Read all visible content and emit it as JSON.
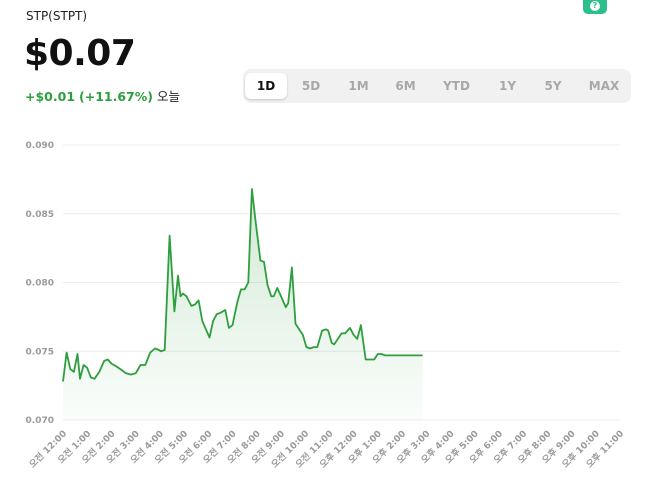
{
  "header": {
    "ticker": "STP(STPT)",
    "price": "$0.07",
    "change_abs": "+$0.01",
    "change_pct": "(+11.67%)",
    "change_period": "오늘"
  },
  "badge_icon": "app-badge-icon",
  "ranges": {
    "items": [
      "1D",
      "5D",
      "1M",
      "6M",
      "YTD",
      "1Y",
      "5Y",
      "MAX"
    ],
    "selected": "1D"
  },
  "colors": {
    "line": "#2e9e3e",
    "positive": "#2e9e3e",
    "badge": "#2bbf8c"
  },
  "chart_data": {
    "type": "area",
    "ylim": [
      0.07,
      0.09
    ],
    "yticks": [
      "0.090",
      "0.085",
      "0.080",
      "0.075",
      "0.070"
    ],
    "grid": true,
    "xlim": [
      0,
      23
    ],
    "xticks": [
      "오전 12:00",
      "오전 1:00",
      "오전 2:00",
      "오전 3:00",
      "오전 4:00",
      "오전 5:00",
      "오전 6:00",
      "오전 7:00",
      "오전 8:00",
      "오전 9:00",
      "오전 10:00",
      "오전 11:00",
      "오후 12:00",
      "오후 1:00",
      "오후 2:00",
      "오후 3:00",
      "오후 4:00",
      "오후 5:00",
      "오후 6:00",
      "오후 7:00",
      "오후 8:00",
      "오후 9:00",
      "오후 10:00",
      "오후 11:00"
    ],
    "x": [
      0,
      0.15,
      0.3,
      0.45,
      0.6,
      0.7,
      0.85,
      1.0,
      1.15,
      1.3,
      1.5,
      1.7,
      1.85,
      2.0,
      2.2,
      2.45,
      2.6,
      2.8,
      3.0,
      3.2,
      3.4,
      3.6,
      3.8,
      3.95,
      4.05,
      4.2,
      4.4,
      4.6,
      4.75,
      4.85,
      4.95,
      5.1,
      5.3,
      5.45,
      5.6,
      5.75,
      5.9,
      6.05,
      6.2,
      6.35,
      6.5,
      6.7,
      6.85,
      7.0,
      7.2,
      7.35,
      7.5,
      7.65,
      7.8,
      7.95,
      8.15,
      8.3,
      8.45,
      8.6,
      8.7,
      8.85,
      9.0,
      9.1,
      9.2,
      9.3,
      9.45,
      9.6,
      9.75,
      9.9,
      10.05,
      10.2,
      10.35,
      10.5,
      10.7,
      10.85,
      10.95,
      11.1,
      11.2,
      11.35,
      11.5,
      11.65,
      11.85,
      12.0,
      12.15,
      12.3,
      12.5,
      12.7,
      12.85,
      13.0,
      13.15,
      13.3,
      13.5,
      13.65,
      13.8,
      13.95,
      14.1,
      14.2,
      14.35,
      14.55,
      14.75,
      14.85
    ],
    "y": [
      0.0728,
      0.0749,
      0.0737,
      0.0735,
      0.0748,
      0.073,
      0.074,
      0.0738,
      0.0731,
      0.073,
      0.0735,
      0.0743,
      0.0744,
      0.0741,
      0.0739,
      0.0736,
      0.0734,
      0.0733,
      0.0734,
      0.074,
      0.074,
      0.0749,
      0.0752,
      0.0751,
      0.075,
      0.0751,
      0.0834,
      0.0779,
      0.0805,
      0.079,
      0.0792,
      0.079,
      0.0783,
      0.0784,
      0.0787,
      0.0772,
      0.0766,
      0.076,
      0.0772,
      0.0777,
      0.0778,
      0.078,
      0.0767,
      0.0769,
      0.0786,
      0.0795,
      0.0795,
      0.08,
      0.0868,
      0.0845,
      0.0816,
      0.0815,
      0.0798,
      0.079,
      0.079,
      0.0796,
      0.079,
      0.0786,
      0.0782,
      0.0785,
      0.0811,
      0.077,
      0.0766,
      0.0762,
      0.0753,
      0.0752,
      0.0753,
      0.0753,
      0.0765,
      0.0766,
      0.0765,
      0.0756,
      0.0755,
      0.0759,
      0.0763,
      0.0763,
      0.0767,
      0.0762,
      0.0759,
      0.0769,
      0.0744,
      0.0744,
      0.0744,
      0.0748,
      0.0748,
      0.0747,
      0.0747,
      0.0747,
      0.0747,
      0.0747,
      0.0747,
      0.0747,
      0.0747,
      0.0747,
      0.0747,
      0.0747
    ]
  }
}
